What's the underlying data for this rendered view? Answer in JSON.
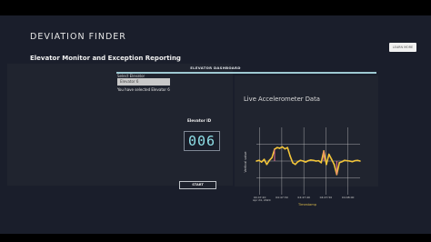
{
  "header": {
    "title": "DEVIATION FINDER",
    "subtitle": "Elevator Monitor and Exception Reporting",
    "learn_more": "LEARN MORE"
  },
  "dashboard": {
    "title": "ELEVATOR DASHBOARD",
    "select": {
      "label": "Select Elevator",
      "value": "Elevator 6",
      "message": "You have selected Elevator 6"
    },
    "elevator_id_label": "Elevator ID",
    "elevator_id_value": "006",
    "start_label": "START"
  },
  "chart": {
    "title": "Live Accelerometer Data",
    "ylabel": "Vertical value",
    "xlabel": "Timestamp",
    "date_label": "Apr 24, 2020"
  },
  "colors": {
    "accent": "#9ec9d2",
    "series": "#f2c53a",
    "markers": "#e86c8f",
    "display_text": "#8fe0e8"
  },
  "chart_data": {
    "type": "line",
    "title": "Live Accelerometer Data",
    "xlabel": "Timestamp",
    "ylabel": "Vertical value",
    "x_ticks": [
      "04:47:20",
      "04:47:30",
      "04:47:40",
      "04:47:50",
      "04:48:00"
    ],
    "y_ticks": [
      "",
      "",
      ""
    ],
    "series": [
      {
        "values": [
          0,
          0.02,
          -0.03,
          0.05,
          -0.1,
          0.02,
          0.1,
          0.35,
          0.4,
          0.38,
          0.42,
          0.36,
          0.4,
          0.15,
          -0.05,
          -0.1,
          -0.02,
          0.02,
          0.0,
          -0.03,
          0.01,
          0.03,
          0.02,
          0.0,
          0.01,
          -0.05,
          0.3,
          -0.1,
          0.2,
          0.05,
          -0.1,
          -0.4,
          -0.05,
          -0.02,
          0.02,
          0.01,
          0.0,
          -0.02,
          0.01,
          0.02,
          0.0
        ]
      }
    ]
  }
}
